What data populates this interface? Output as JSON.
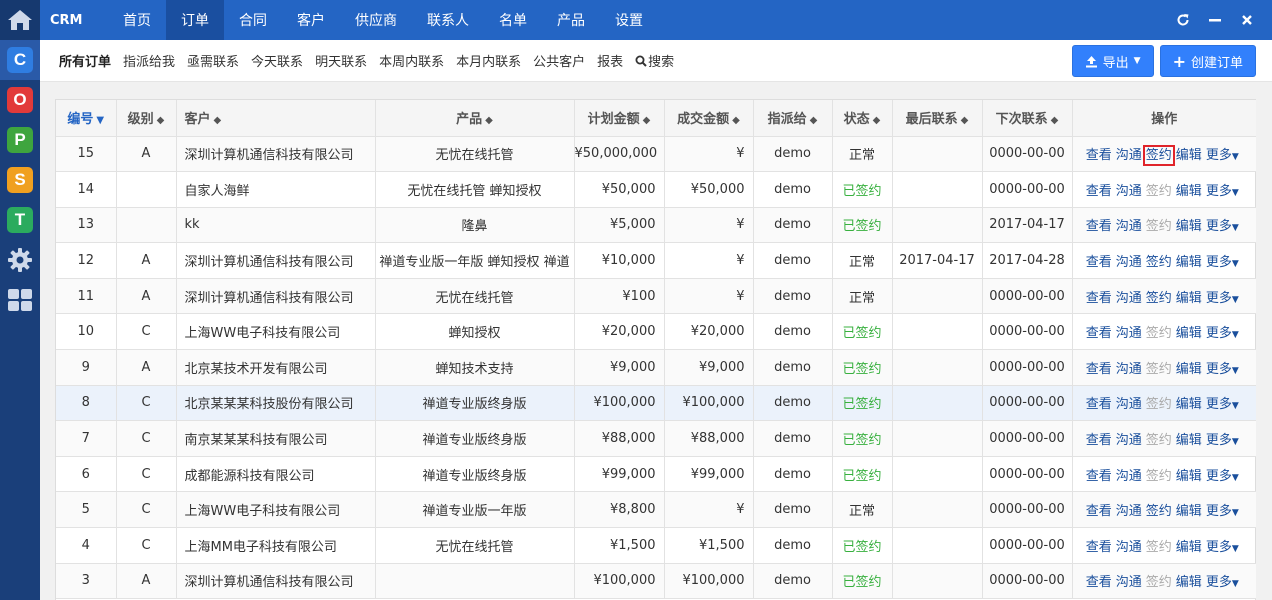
{
  "rail": {
    "apps": [
      {
        "letter": "C",
        "color": "#2f7de1"
      },
      {
        "letter": "O",
        "color": "#e23a3a"
      },
      {
        "letter": "P",
        "color": "#3ea53e"
      },
      {
        "letter": "S",
        "color": "#f0a020"
      },
      {
        "letter": "T",
        "color": "#2bab5e"
      }
    ]
  },
  "topnav": {
    "brand": "CRM",
    "items": [
      "首页",
      "订单",
      "合同",
      "客户",
      "供应商",
      "联系人",
      "名单",
      "产品",
      "设置"
    ],
    "active": "订单"
  },
  "subnav": {
    "items": [
      "所有订单",
      "指派给我",
      "亟需联系",
      "今天联系",
      "明天联系",
      "本周内联系",
      "本月内联系",
      "公共客户",
      "报表",
      "搜索"
    ],
    "export_label": "导出",
    "create_label": "创建订单"
  },
  "table": {
    "headers": [
      "编号",
      "级别",
      "客户",
      "产品",
      "计划金额",
      "成交金额",
      "指派给",
      "状态",
      "最后联系",
      "下次联系",
      "操作"
    ],
    "actions": {
      "view": "查看",
      "contact": "沟通",
      "sign": "签约",
      "edit": "编辑",
      "more": "更多"
    },
    "rows": [
      {
        "id": "15",
        "level": "A",
        "customer": "深圳计算机通信科技有限公司",
        "product": "无忧在线托管",
        "plan": "¥50,000,000",
        "deal": "¥",
        "assignee": "demo",
        "status": "正常",
        "last": "",
        "next": "0000-00-00",
        "sign_enabled": true
      },
      {
        "id": "14",
        "level": "",
        "customer": "自家人海鲜",
        "product": "无忧在线托管 蝉知授权",
        "plan": "¥50,000",
        "deal": "¥50,000",
        "assignee": "demo",
        "status": "已签约",
        "last": "",
        "next": "0000-00-00",
        "sign_enabled": false
      },
      {
        "id": "13",
        "level": "",
        "customer": "kk",
        "product": "隆鼻",
        "plan": "¥5,000",
        "deal": "¥",
        "assignee": "demo",
        "status": "已签约",
        "last": "",
        "next": "2017-04-17",
        "sign_enabled": false
      },
      {
        "id": "12",
        "level": "A",
        "customer": "深圳计算机通信科技有限公司",
        "product": "禅道专业版一年版 蝉知授权 禅道",
        "plan": "¥10,000",
        "deal": "¥",
        "assignee": "demo",
        "status": "正常",
        "last": "2017-04-17",
        "next": "2017-04-28",
        "sign_enabled": true
      },
      {
        "id": "11",
        "level": "A",
        "customer": "深圳计算机通信科技有限公司",
        "product": "无忧在线托管",
        "plan": "¥100",
        "deal": "¥",
        "assignee": "demo",
        "status": "正常",
        "last": "",
        "next": "0000-00-00",
        "sign_enabled": true
      },
      {
        "id": "10",
        "level": "C",
        "customer": "上海WW电子科技有限公司",
        "product": "蝉知授权",
        "plan": "¥20,000",
        "deal": "¥20,000",
        "assignee": "demo",
        "status": "已签约",
        "last": "",
        "next": "0000-00-00",
        "sign_enabled": false
      },
      {
        "id": "9",
        "level": "A",
        "customer": "北京某技术开发有限公司",
        "product": "蝉知技术支持",
        "plan": "¥9,000",
        "deal": "¥9,000",
        "assignee": "demo",
        "status": "已签约",
        "last": "",
        "next": "0000-00-00",
        "sign_enabled": false
      },
      {
        "id": "8",
        "level": "C",
        "customer": "北京某某某科技股份有限公司",
        "product": "禅道专业版终身版",
        "plan": "¥100,000",
        "deal": "¥100,000",
        "assignee": "demo",
        "status": "已签约",
        "last": "",
        "next": "0000-00-00",
        "sign_enabled": false
      },
      {
        "id": "7",
        "level": "C",
        "customer": "南京某某某科技有限公司",
        "product": "禅道专业版终身版",
        "plan": "¥88,000",
        "deal": "¥88,000",
        "assignee": "demo",
        "status": "已签约",
        "last": "",
        "next": "0000-00-00",
        "sign_enabled": false
      },
      {
        "id": "6",
        "level": "C",
        "customer": "成都能源科技有限公司",
        "product": "禅道专业版终身版",
        "plan": "¥99,000",
        "deal": "¥99,000",
        "assignee": "demo",
        "status": "已签约",
        "last": "",
        "next": "0000-00-00",
        "sign_enabled": false
      },
      {
        "id": "5",
        "level": "C",
        "customer": "上海WW电子科技有限公司",
        "product": "禅道专业版一年版",
        "plan": "¥8,800",
        "deal": "¥",
        "assignee": "demo",
        "status": "正常",
        "last": "",
        "next": "0000-00-00",
        "sign_enabled": true
      },
      {
        "id": "4",
        "level": "C",
        "customer": "上海MM电子科技有限公司",
        "product": "无忧在线托管",
        "plan": "¥1,500",
        "deal": "¥1,500",
        "assignee": "demo",
        "status": "已签约",
        "last": "",
        "next": "0000-00-00",
        "sign_enabled": false
      },
      {
        "id": "3",
        "level": "A",
        "customer": "深圳计算机通信科技有限公司",
        "product": "",
        "plan": "¥100,000",
        "deal": "¥100,000",
        "assignee": "demo",
        "status": "已签约",
        "last": "",
        "next": "0000-00-00",
        "sign_enabled": false
      }
    ]
  }
}
